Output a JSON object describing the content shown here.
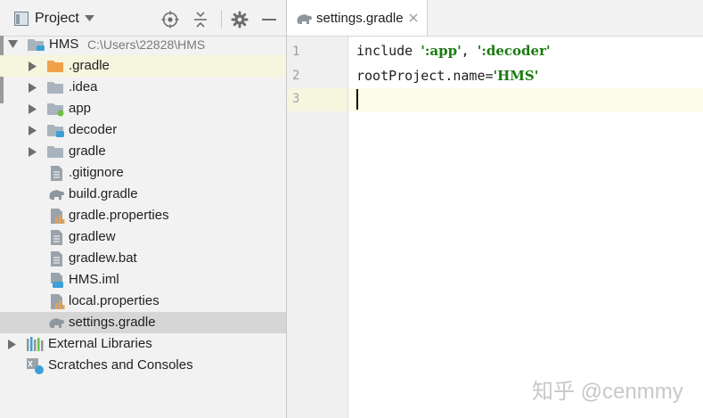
{
  "project_panel": {
    "title": "Project",
    "tree": [
      {
        "label": "HMS",
        "path": "C:\\Users\\22828\\HMS",
        "icon": "module-folder-icon",
        "expanded": true
      },
      {
        "label": ".gradle",
        "icon": "folder-orange-icon",
        "expanded": false
      },
      {
        "label": ".idea",
        "icon": "folder-icon",
        "expanded": false
      },
      {
        "label": "app",
        "icon": "android-module-folder-icon",
        "expanded": false
      },
      {
        "label": "decoder",
        "icon": "module-folder-icon",
        "expanded": false
      },
      {
        "label": "gradle",
        "icon": "folder-icon",
        "expanded": false
      },
      {
        "label": ".gitignore",
        "icon": "text-file-icon"
      },
      {
        "label": "build.gradle",
        "icon": "gradle-elephant-icon"
      },
      {
        "label": "gradle.properties",
        "icon": "properties-file-icon"
      },
      {
        "label": "gradlew",
        "icon": "text-file-icon"
      },
      {
        "label": "gradlew.bat",
        "icon": "text-file-icon"
      },
      {
        "label": "HMS.iml",
        "icon": "iml-file-icon"
      },
      {
        "label": "local.properties",
        "icon": "properties-file-icon"
      },
      {
        "label": "settings.gradle",
        "icon": "gradle-elephant-icon",
        "selected": true
      },
      {
        "label": "External Libraries",
        "icon": "libraries-icon",
        "expanded": false
      },
      {
        "label": "Scratches and Consoles",
        "icon": "scratches-icon"
      }
    ]
  },
  "editor": {
    "tab": {
      "label": "settings.gradle",
      "icon": "gradle-elephant-icon"
    },
    "line_numbers": [
      "1",
      "2",
      "3"
    ],
    "lines": [
      {
        "plain1": "include ",
        "str1": "':app'",
        "plain2": ", ",
        "str2": "':decoder'"
      },
      {
        "plain1": "rootProject.name=",
        "str1": "'HMS'"
      },
      {
        "plain1": ""
      }
    ],
    "current_line": 3
  },
  "watermark": "知乎 @cenmmy",
  "colors": {
    "string": "#1b7a10",
    "current_line": "#fdfcea",
    "selected_row": "#d6d6d6",
    "folder": "#a9b3bd",
    "folder_orange": "#f0a14b",
    "module_badge": "#3d9fd8"
  }
}
